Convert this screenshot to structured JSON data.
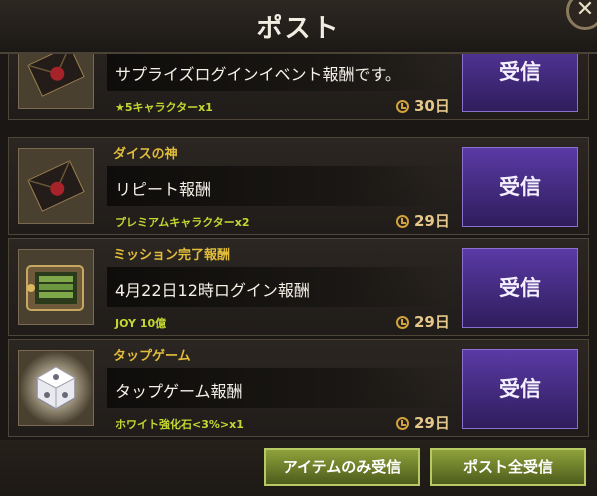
{
  "header": {
    "title": "ポスト",
    "close_label": "✕"
  },
  "mails": [
    {
      "sender": "",
      "title": "サプライズログインイベント報酬です。",
      "reward": "★5キャラクターx1",
      "days": "30日",
      "button": "受信",
      "icon": "envelope-icon"
    },
    {
      "sender": "ダイスの神",
      "title": "リピート報酬",
      "reward": "プレミアムキャラクターx2",
      "days": "29日",
      "button": "受信",
      "icon": "envelope-icon"
    },
    {
      "sender": "ミッション完了報酬",
      "title": "4月22日12時ログイン報酬",
      "reward": "JOY 10億",
      "days": "29日",
      "button": "受信",
      "icon": "safe-icon"
    },
    {
      "sender": "タップゲーム",
      "title": "タップゲーム報酬",
      "reward": "ホワイト強化石<3%>x1",
      "days": "29日",
      "button": "受信",
      "icon": "white-gem-icon"
    }
  ],
  "footer": {
    "receive_items_only": "アイテムのみ受信",
    "receive_all": "ポスト全受信"
  }
}
